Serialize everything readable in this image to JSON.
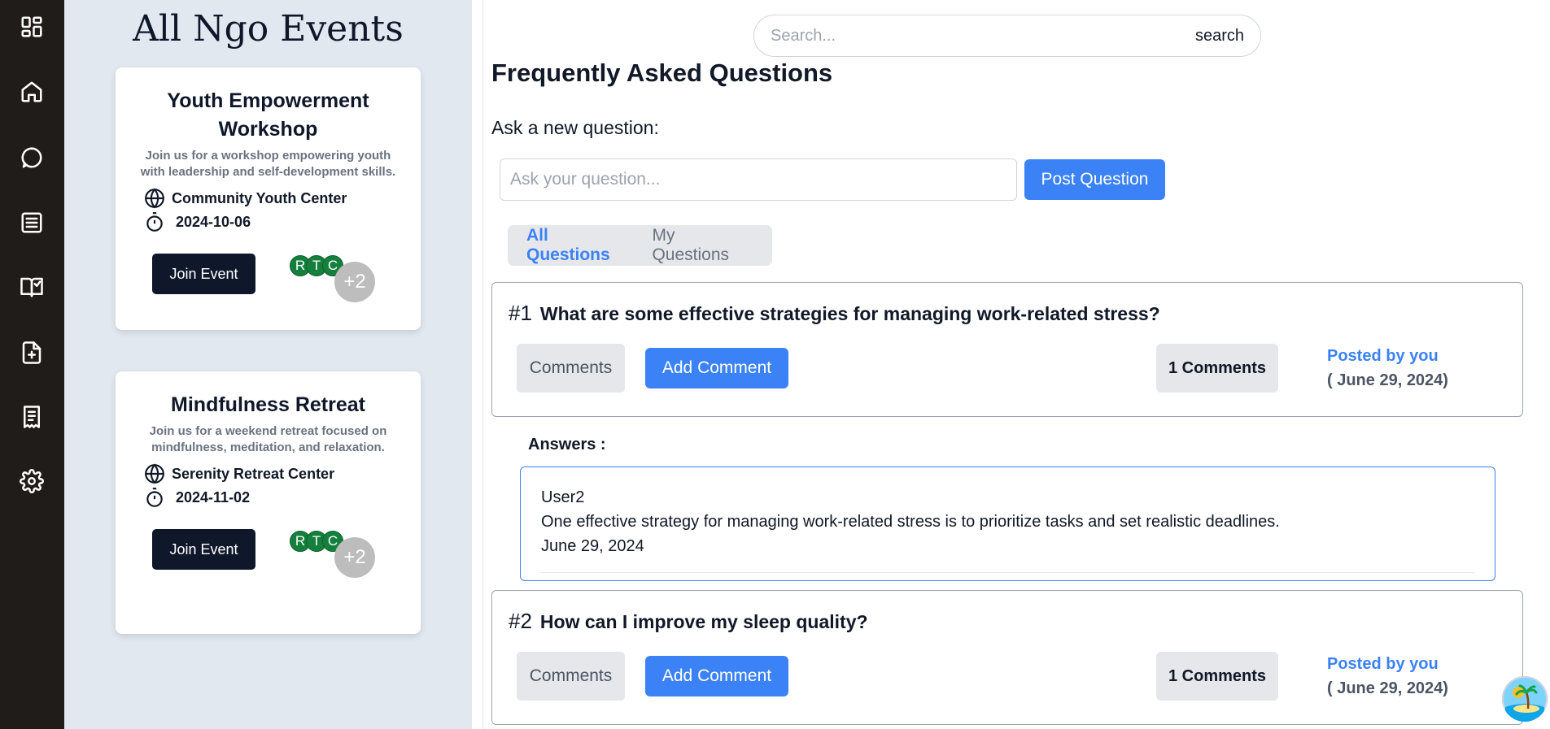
{
  "sidebar": {
    "icons": [
      "dashboard-icon",
      "home-icon",
      "chat-icon",
      "list-icon",
      "book-icon",
      "add-file-icon",
      "receipt-icon",
      "gear-icon"
    ]
  },
  "events": {
    "title": "All Ngo Events",
    "cards": [
      {
        "title": "Youth Empowerment Workshop",
        "description": "Join us for a workshop empowering youth with leadership and self-development skills.",
        "location": "Community Youth Center",
        "date": "2024-10-06",
        "join_label": "Join Event",
        "avatars": [
          "R",
          "T",
          "C"
        ],
        "more": "+2"
      },
      {
        "title": "Mindfulness Retreat",
        "description": "Join us for a weekend retreat focused on mindfulness, meditation, and relaxation.",
        "location": "Serenity Retreat Center",
        "date": "2024-11-02",
        "join_label": "Join Event",
        "avatars": [
          "R",
          "T",
          "C"
        ],
        "more": "+2"
      }
    ]
  },
  "search": {
    "placeholder": "Search...",
    "button_label": "search"
  },
  "faq": {
    "title": "Frequently Asked Questions",
    "ask_label": "Ask a new question:",
    "ask_placeholder": "Ask your question...",
    "post_label": "Post Question",
    "tabs": [
      {
        "label": "All Questions",
        "active": true
      },
      {
        "label": "My Questions",
        "active": false
      }
    ],
    "questions": [
      {
        "number": "#1",
        "text": "What are some effective strategies for managing work-related stress?",
        "comments_label": "Comments",
        "add_comment_label": "Add Comment",
        "count_label": "1 Comments",
        "posted_by": "Posted by you",
        "posted_date": "( June 29, 2024)"
      },
      {
        "number": "#2",
        "text": "How can I improve my sleep quality?",
        "comments_label": "Comments",
        "add_comment_label": "Add Comment",
        "count_label": "1 Comments",
        "posted_by": "Posted by you",
        "posted_date": "( June 29, 2024)"
      }
    ],
    "answers_label": "Answers :",
    "answer": {
      "user": "User2",
      "text": "One effective strategy for managing work-related stress is to prioritize tasks and set realistic deadlines.",
      "date": "June 29, 2024"
    }
  },
  "colors": {
    "sidebar_bg": "#1f1c1a",
    "panel_bg": "#e2e8f0",
    "accent": "#3b82f6",
    "dark_button": "#0f172a",
    "avatar_green": "#15803d"
  }
}
